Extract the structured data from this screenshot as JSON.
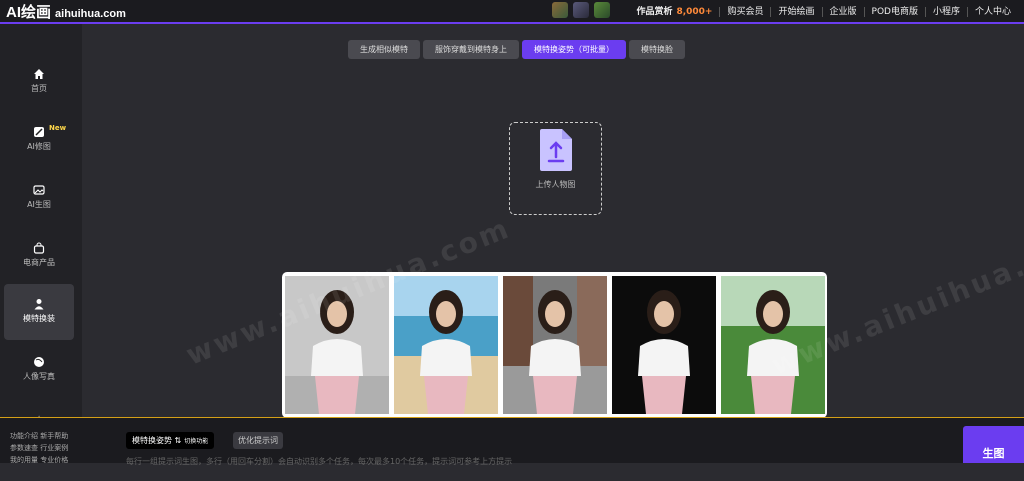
{
  "header": {
    "logo": "AI绘画",
    "domain": "aihuihua.com",
    "works_label": "作品赏析",
    "works_count": "8,000+",
    "nav": [
      "购买会员",
      "开始绘画",
      "企业版",
      "POD电商版",
      "小程序",
      "个人中心"
    ]
  },
  "sidebar": {
    "items": [
      {
        "label": "首页",
        "icon": "home-icon"
      },
      {
        "label": "AI修图",
        "icon": "image-edit-icon",
        "badge": "New"
      },
      {
        "label": "AI生图",
        "icon": "image-generate-icon"
      },
      {
        "label": "电商产品",
        "icon": "shopping-bag-icon"
      },
      {
        "label": "模特换装",
        "icon": "model-icon"
      },
      {
        "label": "人像写真",
        "icon": "portrait-icon"
      }
    ]
  },
  "tabs": [
    "生成相似模特",
    "服饰穿戴到模特身上",
    "模特换姿势（可批量）",
    "模特换脸"
  ],
  "upload": {
    "label": "上传人物图"
  },
  "watermark": "www.aihuihua.com",
  "bottom": {
    "help": [
      "功能介绍",
      "新手帮助",
      "参数速查",
      "行业案例",
      "我的用量",
      "专业价格"
    ],
    "mode_chip": "模特换姿势",
    "mode_switch": "切换功能",
    "optimize_chip": "优化提示词",
    "input_hint": "每行一组提示词生图，多行（用回车分割）会自动识别多个任务，每次最多10个任务，提示词可参考上方提示",
    "generate": "生图"
  },
  "colors": {
    "accent": "#6b3df0",
    "highlight": "#ff8a3a",
    "gold": "#d4a017"
  }
}
